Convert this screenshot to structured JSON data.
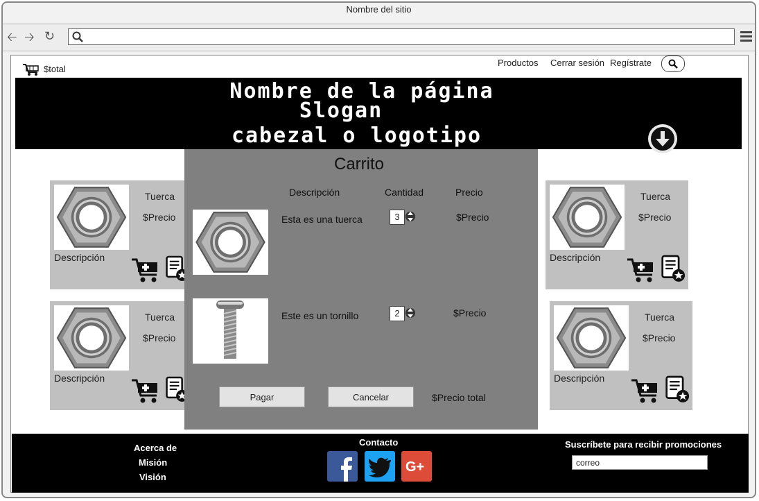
{
  "browser": {
    "title": "Nombre del sitio",
    "url_value": ""
  },
  "topnav": {
    "cart_total": "$total",
    "links": [
      "Productos",
      "Cerrar sesión",
      "Regístrate"
    ]
  },
  "banner": {
    "line1": "Nombre de la página",
    "line2": "Slogan",
    "line3": "cabezal o logotipo"
  },
  "products": [
    {
      "name": "Tuerca",
      "price": "$Precio",
      "description": "Descripción"
    },
    {
      "name": "Tuerca",
      "price": "$Precio",
      "description": "Descripción"
    },
    {
      "name": "Tuerca",
      "price": "$Precio",
      "description": "Descripción"
    },
    {
      "name": "Tuerca",
      "price": "$Precio",
      "description": "Descripción"
    }
  ],
  "cart": {
    "title": "Carrito",
    "headers": {
      "description": "Descripción",
      "quantity": "Cantidad",
      "price": "Precio"
    },
    "items": [
      {
        "description": "Esta es una tuerca",
        "quantity": "3",
        "price": "$Precio",
        "icon": "nut-image"
      },
      {
        "description": "Este es un tornillo",
        "quantity": "2",
        "price": "$Precio",
        "icon": "screw-image"
      }
    ],
    "pay_label": "Pagar",
    "cancel_label": "Cancelar",
    "total": "$Precio total"
  },
  "footer": {
    "about": [
      "Acerca de",
      "Misión",
      "Visión"
    ],
    "contact": "Contacto",
    "social": [
      "facebook-icon",
      "twitter-icon",
      "google-plus-icon"
    ],
    "subscribe": "Suscríbete para recibir promociones",
    "email_value": "correo"
  },
  "colors": {
    "banner": "#000000",
    "modal": "#808080",
    "card": "#c0c0c0",
    "facebook": "#3b5998",
    "twitter": "#1da1f2",
    "google": "#dd4b39"
  }
}
